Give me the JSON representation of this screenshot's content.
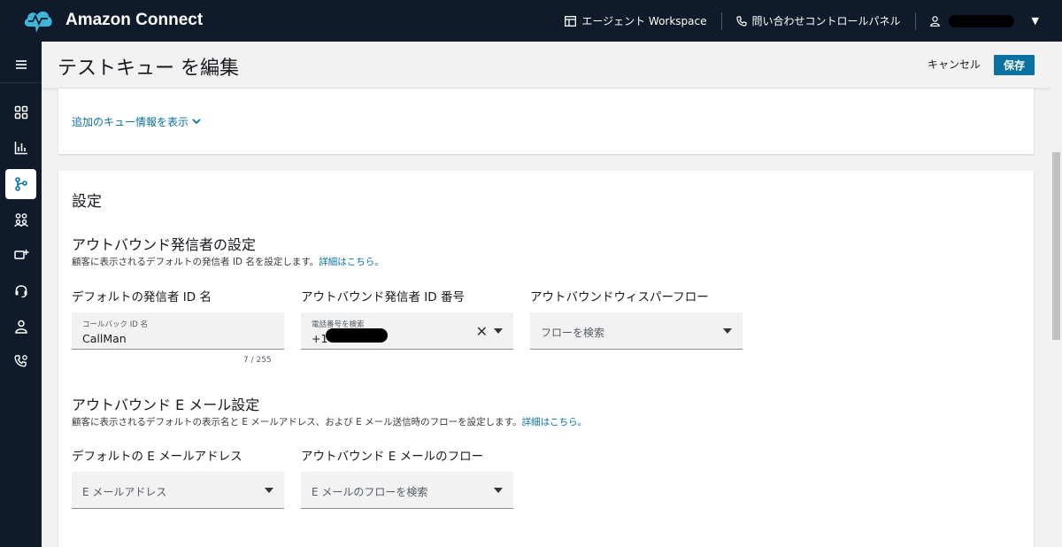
{
  "brand": {
    "name": "Amazon Connect"
  },
  "top_nav": {
    "agent_workspace": "エージェント Workspace",
    "contact_control_panel": "問い合わせコントロールパネル"
  },
  "header": {
    "title": "テストキュー を編集",
    "cancel": "キャンセル",
    "save": "保存"
  },
  "queue_info": {
    "show_more": "追加のキュー情報を表示"
  },
  "settings": {
    "title": "設定",
    "outbound_caller": {
      "title": "アウトバウンド発信者の設定",
      "description": "顧客に表示されるデフォルトの発信者 ID 名を設定します。",
      "details_link": "詳細はこちら。",
      "caller_id_name": {
        "label": "デフォルトの発信者 ID 名",
        "small_label": "コールバック ID 名",
        "value": "CallMan",
        "counter": "7 / 255"
      },
      "caller_id_number": {
        "label": "アウトバウンド発信者 ID 番号",
        "small_label": "電話番号を検索",
        "value_prefix": "+1"
      },
      "whisper_flow": {
        "label": "アウトバウンドウィスパーフロー",
        "placeholder": "フローを検索"
      }
    },
    "outbound_email": {
      "title": "アウトバウンド E メール設定",
      "description": "顧客に表示されるデフォルトの表示名と E メールアドレス、および E メール送信時のフローを設定します。",
      "details_link": "詳細はこちら。",
      "email_address": {
        "label": "デフォルトの E メールアドレス",
        "placeholder": "E メールアドレス"
      },
      "email_flow": {
        "label": "アウトバウンド E メールのフロー",
        "placeholder": "E メールのフローを検索"
      }
    }
  },
  "colors": {
    "topbar": "#0f1b2a",
    "primary": "#0972a3",
    "logo": "#3fb6d8"
  }
}
